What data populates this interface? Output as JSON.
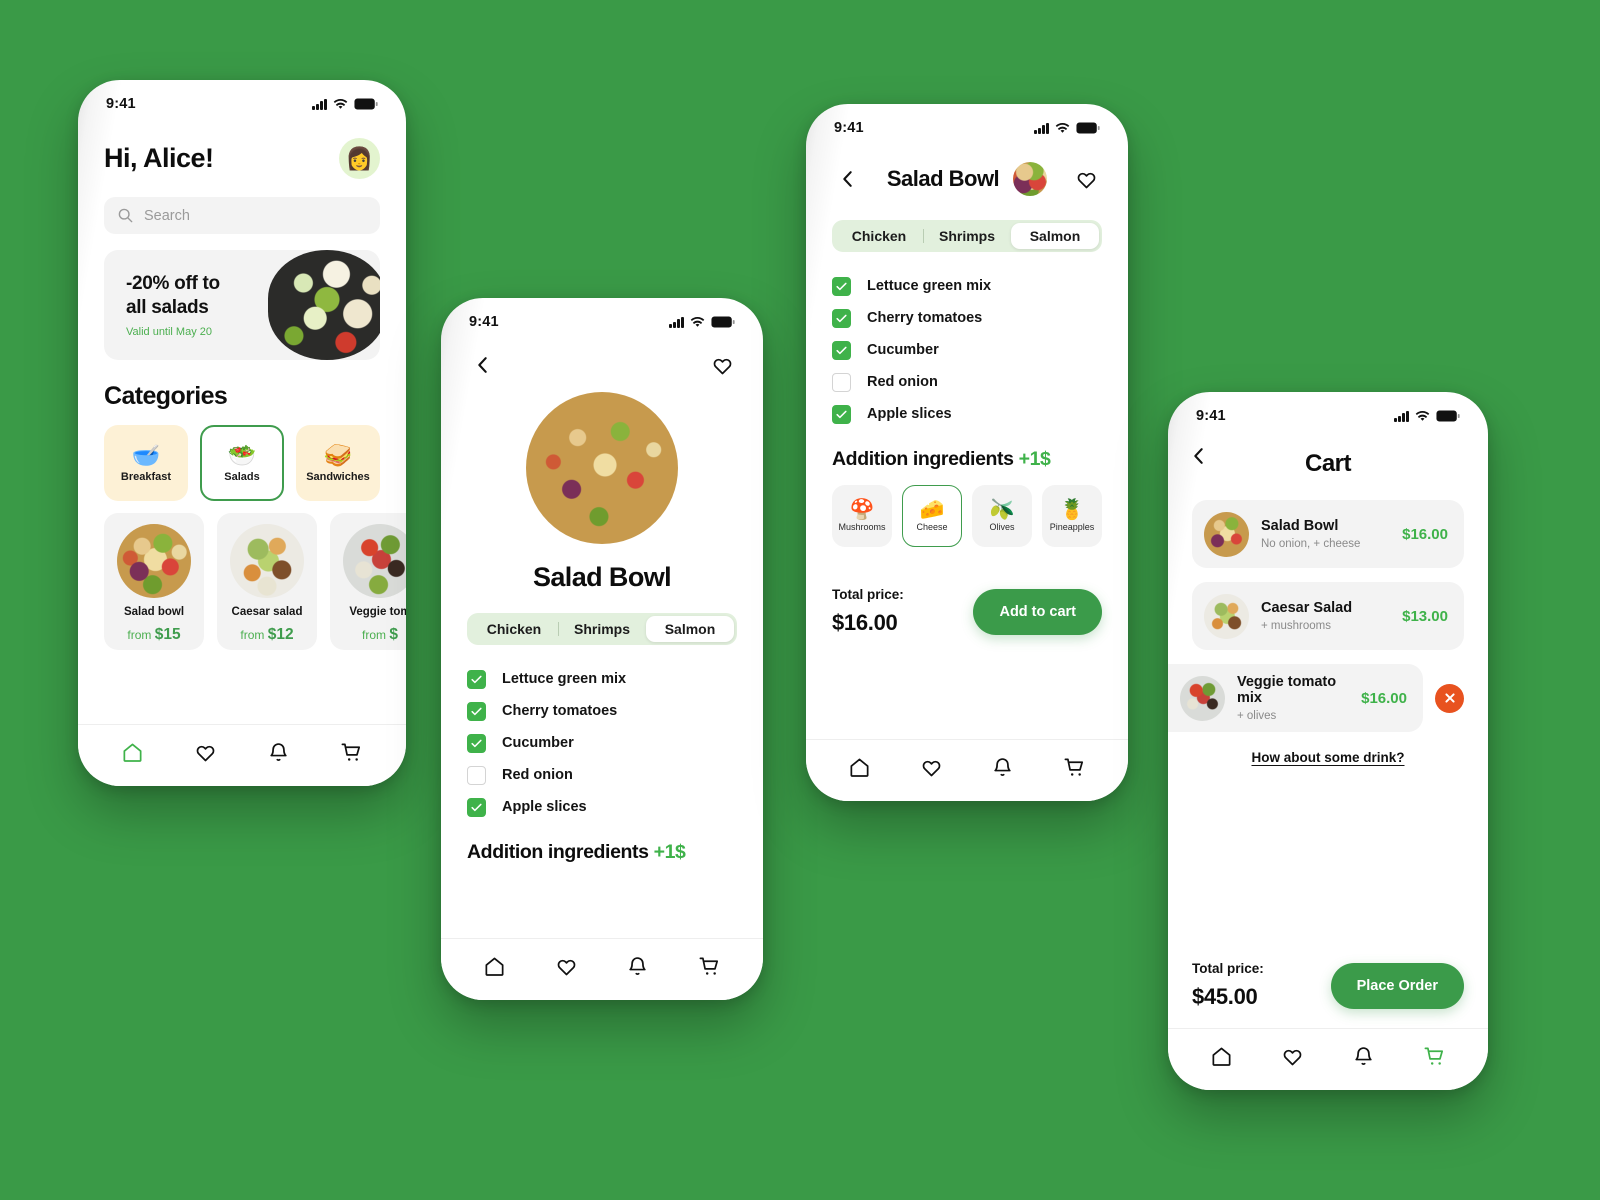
{
  "theme": {
    "background": "#3a9a47",
    "primary_green": "#3b9b4a",
    "accent_green": "#3fb24a",
    "delete_red": "#e8521f",
    "card_gray": "#f3f3f3",
    "category_cream": "#fdf1d6",
    "segment_bg": "#e2f0dd"
  },
  "status_bar": {
    "time": "9:41"
  },
  "home": {
    "greeting": "Hi, Alice!",
    "avatar_icon": "woman-avatar",
    "search": {
      "placeholder": "Search",
      "value": "",
      "icon": "search-icon"
    },
    "promo": {
      "title": "-20% off to\nall salads",
      "title_line1": "-20% off to",
      "title_line2": "all salads",
      "subtitle": "Valid until May 20"
    },
    "categories_title": "Categories",
    "categories": [
      {
        "label": "Breakfast",
        "icon": "breakfast-bowl-icon",
        "emoji": "🥣",
        "active": false
      },
      {
        "label": "Salads",
        "icon": "salad-bowl-icon",
        "emoji": "🥗",
        "active": true
      },
      {
        "label": "Sandwiches",
        "icon": "sandwich-icon",
        "emoji": "🥪",
        "active": false
      }
    ],
    "dishes": [
      {
        "name": "Salad bowl",
        "price_prefix": "from",
        "price": "$15"
      },
      {
        "name": "Caesar salad",
        "price_prefix": "from",
        "price": "$12"
      },
      {
        "name": "Veggie tom",
        "price_prefix": "from",
        "price": "$"
      }
    ]
  },
  "detail": {
    "back_icon": "chevron-left-icon",
    "favorite_icon": "heart-icon",
    "title": "Salad Bowl",
    "variants": [
      {
        "label": "Chicken",
        "active": false
      },
      {
        "label": "Shrimps",
        "active": false
      },
      {
        "label": "Salmon",
        "active": true
      }
    ],
    "ingredients": [
      {
        "label": "Lettuce green mix",
        "checked": true
      },
      {
        "label": "Cherry tomatoes",
        "checked": true
      },
      {
        "label": "Cucumber",
        "checked": true
      },
      {
        "label": "Red onion",
        "checked": false
      },
      {
        "label": "Apple slices",
        "checked": true
      }
    ],
    "additions_heading": "Addition ingredients",
    "additions_price": "+1$"
  },
  "ingredients_screen": {
    "back_icon": "chevron-left-icon",
    "title": "Salad Bowl",
    "favorite_icon": "heart-icon",
    "variants": [
      {
        "label": "Chicken",
        "active": false
      },
      {
        "label": "Shrimps",
        "active": false
      },
      {
        "label": "Salmon",
        "active": true
      }
    ],
    "ingredients": [
      {
        "label": "Lettuce green mix",
        "checked": true
      },
      {
        "label": "Cherry tomatoes",
        "checked": true
      },
      {
        "label": "Cucumber",
        "checked": true
      },
      {
        "label": "Red onion",
        "checked": false
      },
      {
        "label": "Apple slices",
        "checked": true
      }
    ],
    "additions_heading": "Addition ingredients",
    "additions_price": "+1$",
    "additions": [
      {
        "label": "Mushrooms",
        "emoji": "🍄",
        "icon": "mushroom-icon",
        "active": false
      },
      {
        "label": "Cheese",
        "emoji": "🧀",
        "icon": "cheese-icon",
        "active": true
      },
      {
        "label": "Olives",
        "emoji": "🫒",
        "icon": "olives-icon",
        "active": false
      },
      {
        "label": "Pineapples",
        "emoji": "🍍",
        "icon": "pineapple-icon",
        "active": false
      }
    ],
    "total_label": "Total price:",
    "total_value": "$16.00",
    "cta_label": "Add to cart"
  },
  "cart": {
    "back_icon": "chevron-left-icon",
    "title": "Cart",
    "items": [
      {
        "name": "Salad Bowl",
        "options": "No onion, + cheese",
        "price": "$16.00",
        "removable": false
      },
      {
        "name": "Caesar Salad",
        "options": "+ mushrooms",
        "price": "$13.00",
        "removable": false
      },
      {
        "name": "Veggie tomato mix",
        "options": "+ olives",
        "price": "$16.00",
        "removable": true
      }
    ],
    "delete_icon": "close-circle-icon",
    "drink_link": "How about some drink?",
    "total_label": "Total price:",
    "total_value": "$45.00",
    "cta_label": "Place Order"
  },
  "nav": {
    "items": [
      {
        "icon": "home-icon",
        "label": "Home"
      },
      {
        "icon": "heart-icon",
        "label": "Favorites"
      },
      {
        "icon": "bell-icon",
        "label": "Notifications"
      },
      {
        "icon": "cart-icon",
        "label": "Cart"
      }
    ],
    "active": {
      "home": 0,
      "detail": -1,
      "ingredients": -1,
      "cart": 3
    }
  }
}
